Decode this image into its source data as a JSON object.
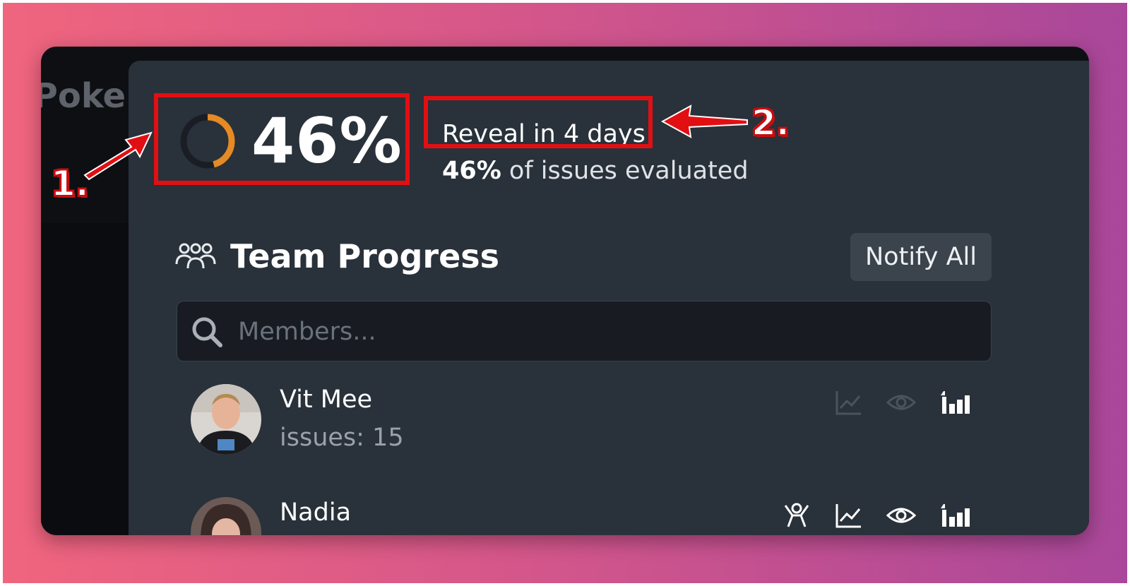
{
  "app": {
    "background_title": "Poke"
  },
  "progress": {
    "percent_display": "46%",
    "percent_value": 46,
    "reveal_text": "Reveal in 4 days",
    "evaluated_bold": "46%",
    "evaluated_rest": " of issues evaluated"
  },
  "team": {
    "title": "Team Progress",
    "notify_label": "Notify All",
    "search_placeholder": "Members..."
  },
  "members": [
    {
      "name": "Vit Mee",
      "issues": "issues: 15",
      "actions": [
        "trend-chart-icon",
        "eye-icon",
        "ranking-bars-icon"
      ],
      "actions_enabled": [
        false,
        false,
        true
      ]
    },
    {
      "name": "Nadia",
      "actions": [
        "figure-icon",
        "trend-chart-icon",
        "eye-icon",
        "ranking-bars-icon"
      ],
      "actions_enabled": [
        true,
        true,
        true,
        true
      ]
    }
  ],
  "annotations": {
    "label_1": "1.",
    "label_2": "2."
  },
  "colors": {
    "accent_ring": "#e58a24",
    "annotation_red": "#e20f12",
    "panel_bg": "#29313a",
    "button_bg": "#3b434d"
  }
}
